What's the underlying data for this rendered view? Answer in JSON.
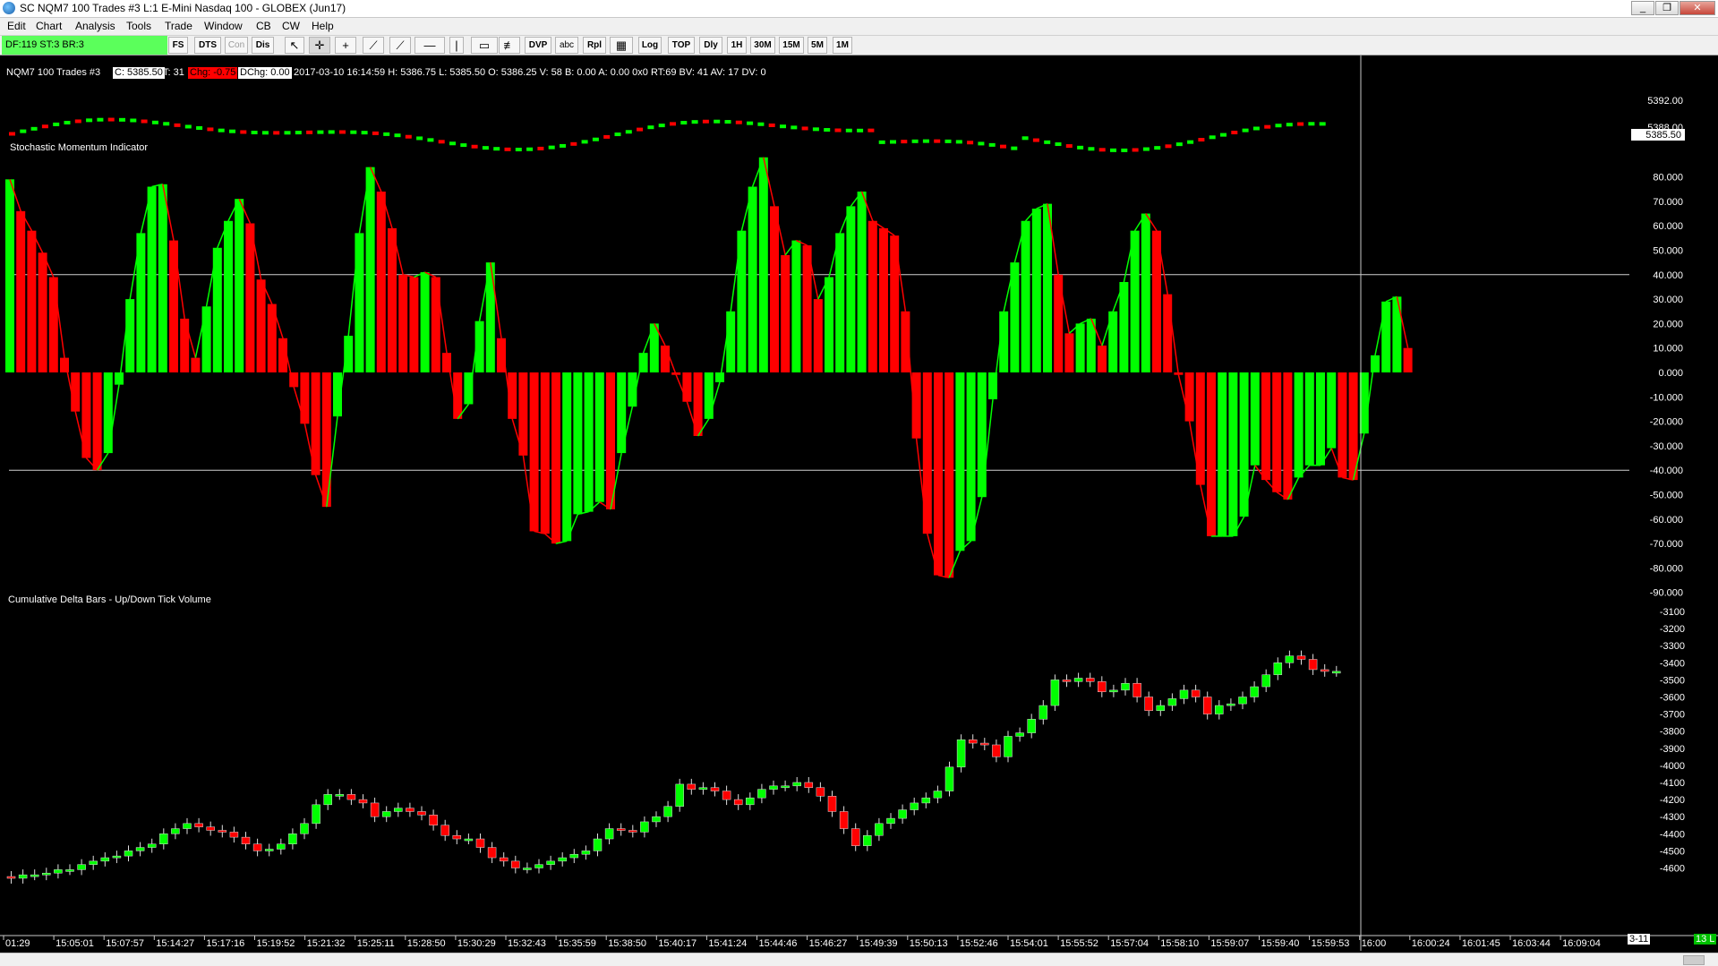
{
  "window": {
    "title": "SC NQM7  100 Trades  #3  L:1  E-Mini Nasdaq 100 - GLOBEX (Jun17)",
    "minimize": "_",
    "restore": "❐",
    "close": "✕"
  },
  "menu": [
    "Edit",
    "Chart",
    "Analysis",
    "Tools",
    "Trade",
    "Window",
    "CB",
    "CW",
    "Help"
  ],
  "toolbar": {
    "status": "DF:119  ST:3  BR:3",
    "buttons": [
      "FS",
      "DTS",
      "Con",
      "Dis",
      "DVP",
      "abc",
      "Rpl",
      "Log",
      "TOP",
      "Dly",
      "1H",
      "30M",
      "15M",
      "5M",
      "1M"
    ]
  },
  "info_bar": {
    "symbol": "NQM7  100 Trades  #3",
    "close": "C: 5385.50",
    "ticks": "T: 31",
    "chg": "Chg: -0.75",
    "dchg": "DChg: 0.00",
    "details": "2017-03-10 16:14:59 H: 5386.75 L: 5385.50 O: 5386.25 V: 58 B: 0.00 A: 0.00 0x0 RT:69 BV: 41 AV: 17 DV: 0"
  },
  "price_axis": {
    "ticks": [
      "5392.00",
      "5388.00"
    ],
    "current": "5385.50"
  },
  "smi": {
    "title": "Stochastic Momentum Indicator",
    "ticks": [
      "80.000",
      "70.000",
      "60.000",
      "50.000",
      "40.000",
      "30.000",
      "20.000",
      "10.000",
      "0.000",
      "-10.000",
      "-20.000",
      "-30.000",
      "-40.000",
      "-50.000",
      "-60.000",
      "-70.000",
      "-80.000",
      "-90.000"
    ]
  },
  "delta": {
    "title": "Cumulative Delta Bars - Up/Down Tick Volume",
    "ticks": [
      "-3100",
      "-3200",
      "-3300",
      "-3400",
      "-3500",
      "-3600",
      "-3700",
      "-3800",
      "-3900",
      "-4000",
      "-4100",
      "-4200",
      "-4300",
      "-4400",
      "-4500",
      "-4600"
    ]
  },
  "time_axis": [
    "01:29",
    "15:05:01",
    "15:07:57",
    "15:14:27",
    "15:17:16",
    "15:19:52",
    "15:21:32",
    "15:25:11",
    "15:28:50",
    "15:30:29",
    "15:32:43",
    "15:35:59",
    "15:38:50",
    "15:40:17",
    "15:41:24",
    "15:44:46",
    "15:46:27",
    "15:49:39",
    "15:50:13",
    "15:52:46",
    "15:54:01",
    "15:55:52",
    "15:57:04",
    "15:58:10",
    "15:59:07",
    "15:59:40",
    "15:59:53",
    "16:00",
    "16:00:24",
    "16:01:45",
    "16:03:44",
    "16:09:04"
  ],
  "date_badge": "3-11",
  "right_badge": "13 L",
  "colors": {
    "up": "#00ff00",
    "down": "#ff0000",
    "background": "#000000",
    "status": "#5bff5b"
  },
  "chart_data": [
    {
      "type": "bar",
      "title": "Stochastic Momentum Indicator",
      "ylim": [
        -90,
        80
      ],
      "reference_lines": [
        40,
        -40
      ],
      "values": [
        79,
        66,
        58,
        49,
        39,
        6,
        -16,
        -35,
        -40,
        -33,
        -5,
        30,
        57,
        76,
        77,
        54,
        22,
        6,
        27,
        51,
        62,
        71,
        61,
        38,
        28,
        14,
        -6,
        -21,
        -42,
        -55,
        -18,
        15,
        57,
        84,
        74,
        59,
        40,
        39,
        41,
        39,
        8,
        -19,
        -13,
        21,
        45,
        14,
        -19,
        -34,
        -65,
        -66,
        -70,
        -69,
        -58,
        -57,
        -53,
        -56,
        -33,
        -14,
        8,
        20,
        11,
        -1,
        -12,
        -26,
        -19,
        -4,
        25,
        58,
        76,
        88,
        68,
        48,
        54,
        52,
        30,
        39,
        57,
        68,
        74,
        62,
        59,
        56,
        25,
        -27,
        -66,
        -83,
        -84,
        -73,
        -69,
        -51,
        -11,
        25,
        45,
        62,
        67,
        69,
        40,
        16,
        20,
        22,
        11,
        25,
        37,
        58,
        65,
        58,
        32,
        -1,
        -20,
        -46,
        -67,
        -67,
        -67,
        -59,
        -38,
        -44,
        -49,
        -52,
        -43,
        -38,
        -38,
        -31,
        -43,
        -44,
        -25,
        7,
        29,
        31,
        10
      ]
    },
    {
      "type": "candlestick",
      "title": "Cumulative Delta Bars - Up/Down Tick Volume",
      "ylim": [
        -4600,
        -3100
      ],
      "open": [
        -4650,
        -4660,
        -4640,
        -4640,
        -4630,
        -4610,
        -4610,
        -4580,
        -4560,
        -4540,
        -4530,
        -4500,
        -4480,
        -4460,
        -4400,
        -4370,
        -4340,
        -4360,
        -4380,
        -4390,
        -4420,
        -4460,
        -4500,
        -4490,
        -4460,
        -4400,
        -4340,
        -4230,
        -4170,
        -4170,
        -4200,
        -4220,
        -4300,
        -4270,
        -4250,
        -4270,
        -4290,
        -4350,
        -4410,
        -4430,
        -4430,
        -4480,
        -4540,
        -4560,
        -4600,
        -4600,
        -4580,
        -4560,
        -4540,
        -4520,
        -4500,
        -4430,
        -4370,
        -4380,
        -4390,
        -4330,
        -4300,
        -4240,
        -4110,
        -4140,
        -4130,
        -4150,
        -4200,
        -4230,
        -4190,
        -4140,
        -4120,
        -4120,
        -4100,
        -4130,
        -4180,
        -4270,
        -4370,
        -4470,
        -4410,
        -4340,
        -4310,
        -4260,
        -4220,
        -4190,
        -4150,
        -4010,
        -3850,
        -3870,
        -3880,
        -3950,
        -3830,
        -3810,
        -3730,
        -3650,
        -3500,
        -3510,
        -3490,
        -3510,
        -3570,
        -3560,
        -3520,
        -3600,
        -3680,
        -3650,
        -3610,
        -3560,
        -3600,
        -3700,
        -3650,
        -3640,
        -3600,
        -3540,
        -3470,
        -3400,
        -3360,
        -3380,
        -3440,
        -3450
      ],
      "close": [
        -4660,
        -4640,
        -4640,
        -4630,
        -4610,
        -4610,
        -4580,
        -4560,
        -4540,
        -4530,
        -4500,
        -4480,
        -4460,
        -4400,
        -4370,
        -4340,
        -4360,
        -4380,
        -4390,
        -4420,
        -4460,
        -4500,
        -4490,
        -4460,
        -4400,
        -4340,
        -4230,
        -4170,
        -4170,
        -4200,
        -4220,
        -4300,
        -4270,
        -4250,
        -4270,
        -4290,
        -4350,
        -4410,
        -4430,
        -4430,
        -4480,
        -4540,
        -4560,
        -4600,
        -4600,
        -4580,
        -4560,
        -4540,
        -4520,
        -4500,
        -4430,
        -4370,
        -4380,
        -4390,
        -4330,
        -4300,
        -4240,
        -4110,
        -4140,
        -4130,
        -4150,
        -4200,
        -4230,
        -4190,
        -4140,
        -4120,
        -4120,
        -4100,
        -4130,
        -4180,
        -4270,
        -4370,
        -4470,
        -4410,
        -4340,
        -4310,
        -4260,
        -4220,
        -4190,
        -4150,
        -4010,
        -3850,
        -3870,
        -3880,
        -3950,
        -3830,
        -3810,
        -3730,
        -3650,
        -3500,
        -3510,
        -3490,
        -3510,
        -3570,
        -3560,
        -3520,
        -3600,
        -3680,
        -3650,
        -3610,
        -3560,
        -3600,
        -3700,
        -3650,
        -3640,
        -3600,
        -3540,
        -3470,
        -3400,
        -3360,
        -3380,
        -3440,
        -3450,
        -3450
      ]
    }
  ]
}
